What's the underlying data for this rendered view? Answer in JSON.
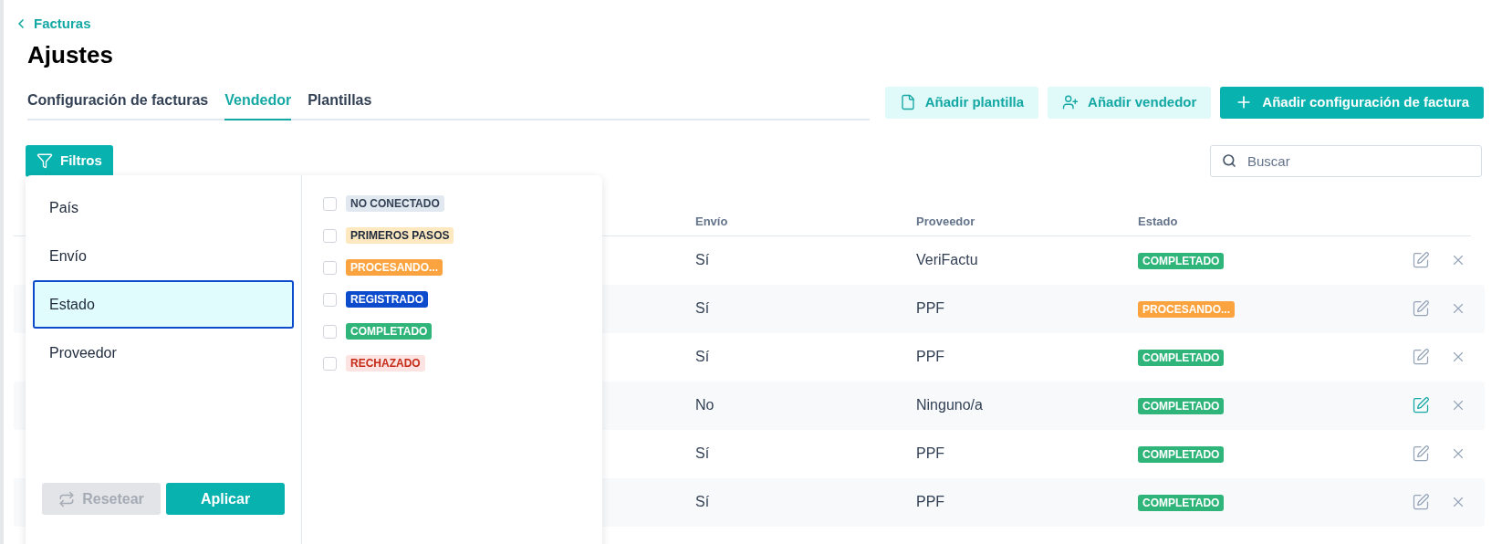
{
  "back_link": "Facturas",
  "title": "Ajustes",
  "tabs": [
    {
      "label": "Configuración de facturas",
      "selected": false
    },
    {
      "label": "Vendedor",
      "selected": true
    },
    {
      "label": "Plantillas",
      "selected": false
    }
  ],
  "actions": [
    {
      "kind": "template",
      "label": "Añadir plantilla"
    },
    {
      "kind": "seller",
      "label": "Añadir vendedor"
    },
    {
      "kind": "config",
      "label": "Añadir configuración de factura"
    }
  ],
  "filter_button": "Filtros",
  "search": {
    "placeholder": "Buscar"
  },
  "filter_panel": {
    "categories": [
      {
        "label": "País",
        "selected": false
      },
      {
        "label": "Envío",
        "selected": false
      },
      {
        "label": "Estado",
        "selected": true
      },
      {
        "label": "Proveedor",
        "selected": false
      }
    ],
    "options": [
      {
        "label": "NO CONECTADO",
        "kind": "neutral",
        "checked": false
      },
      {
        "label": "PRIMEROS PASOS",
        "kind": "pending",
        "checked": false
      },
      {
        "label": "PROCESANDO...",
        "kind": "processing",
        "checked": false
      },
      {
        "label": "REGISTRADO",
        "kind": "registered",
        "checked": false
      },
      {
        "label": "COMPLETADO",
        "kind": "done",
        "checked": false
      },
      {
        "label": "RECHAZADO",
        "kind": "rejected",
        "checked": false
      }
    ],
    "reset": {
      "label": "Resetear",
      "disabled": true
    },
    "apply": "Aplicar"
  },
  "table": {
    "columns": [
      "Envío",
      "Proveedor",
      "Estado"
    ],
    "rows": [
      {
        "envio": "Sí",
        "proveedor": "VeriFactu",
        "estado": {
          "label": "COMPLETADO",
          "kind": "done"
        },
        "edit_active": false
      },
      {
        "envio": "Sí",
        "proveedor": "PPF",
        "estado": {
          "label": "PROCESANDO...",
          "kind": "processing"
        },
        "edit_active": false
      },
      {
        "envio": "Sí",
        "proveedor": "PPF",
        "estado": {
          "label": "COMPLETADO",
          "kind": "done"
        },
        "edit_active": false
      },
      {
        "envio": "No",
        "proveedor": "Ninguno/a",
        "estado": {
          "label": "COMPLETADO",
          "kind": "done"
        },
        "edit_active": true
      },
      {
        "envio": "Sí",
        "proveedor": "PPF",
        "estado": {
          "label": "COMPLETADO",
          "kind": "done"
        },
        "edit_active": false
      },
      {
        "envio": "Sí",
        "proveedor": "PPF",
        "estado": {
          "label": "COMPLETADO",
          "kind": "done"
        },
        "edit_active": false
      }
    ]
  }
}
